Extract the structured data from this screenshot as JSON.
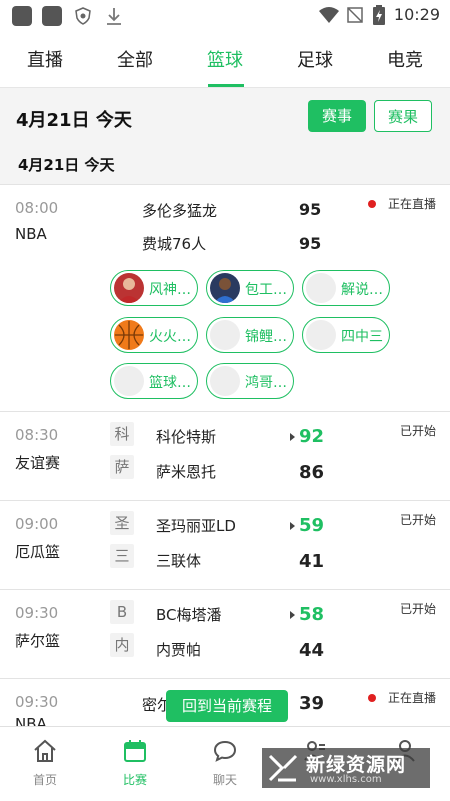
{
  "status_bar": {
    "time": "10:29"
  },
  "tabs": [
    "直播",
    "全部",
    "篮球",
    "足球",
    "电竞"
  ],
  "active_tab": "篮球",
  "date_header": {
    "main": "4月21日 今天",
    "sub": "4月21日   今天",
    "events_button": "赛事",
    "results_button": "赛果"
  },
  "matches": [
    {
      "time": "08:00",
      "league": "NBA",
      "home": "多伦多猛龙",
      "away": "费城76人",
      "home_score": "95",
      "away_score": "95",
      "status": "正在直播",
      "chips": [
        {
          "label": "风神…",
          "icon": "player-avatar"
        },
        {
          "label": "包工…",
          "icon": "player-avatar"
        },
        {
          "label": "解说…",
          "icon": "blank-avatar"
        },
        {
          "label": "火火…",
          "icon": "basketball-avatar"
        },
        {
          "label": "锦鲤…",
          "icon": "blank-avatar"
        },
        {
          "label": "四中三",
          "icon": "blank-avatar"
        },
        {
          "label": "篮球…",
          "icon": "blank-avatar"
        },
        {
          "label": "鸿哥…",
          "icon": "blank-avatar"
        }
      ]
    },
    {
      "time": "08:30",
      "league": "友谊赛",
      "home_abbr": "科",
      "away_abbr": "萨",
      "home": "科伦特斯",
      "away": "萨米恩托",
      "home_score": "92",
      "away_score": "86",
      "status": "已开始"
    },
    {
      "time": "09:00",
      "league": "厄瓜篮",
      "home_abbr": "圣",
      "away_abbr": "三",
      "home": "圣玛丽亚LD",
      "away": "三联体",
      "home_score": "59",
      "away_score": "41",
      "status": "已开始"
    },
    {
      "time": "09:30",
      "league": "萨尔篮",
      "home_abbr": "B",
      "away_abbr": "内",
      "home": "BC梅塔潘",
      "away": "内贾帕",
      "home_score": "58",
      "away_score": "44",
      "status": "已开始"
    },
    {
      "time": "09:30",
      "league": "NBA",
      "home": "密尔",
      "home_score": "39",
      "status": "正在直播"
    }
  ],
  "float_button": "回到当前赛程",
  "bottom_nav": [
    {
      "label": "首页",
      "icon": "home-icon"
    },
    {
      "label": "比赛",
      "icon": "calendar-icon"
    },
    {
      "label": "聊天",
      "icon": "chat-icon"
    },
    {
      "label": "",
      "icon": "user-list-icon"
    },
    {
      "label": "",
      "icon": "user-icon"
    }
  ],
  "active_nav": "比赛",
  "watermark": {
    "text": "新绿资源网",
    "url": "www.xlhs.com"
  },
  "colors": {
    "accent": "#1fbf62",
    "live_dot": "#e02020"
  }
}
